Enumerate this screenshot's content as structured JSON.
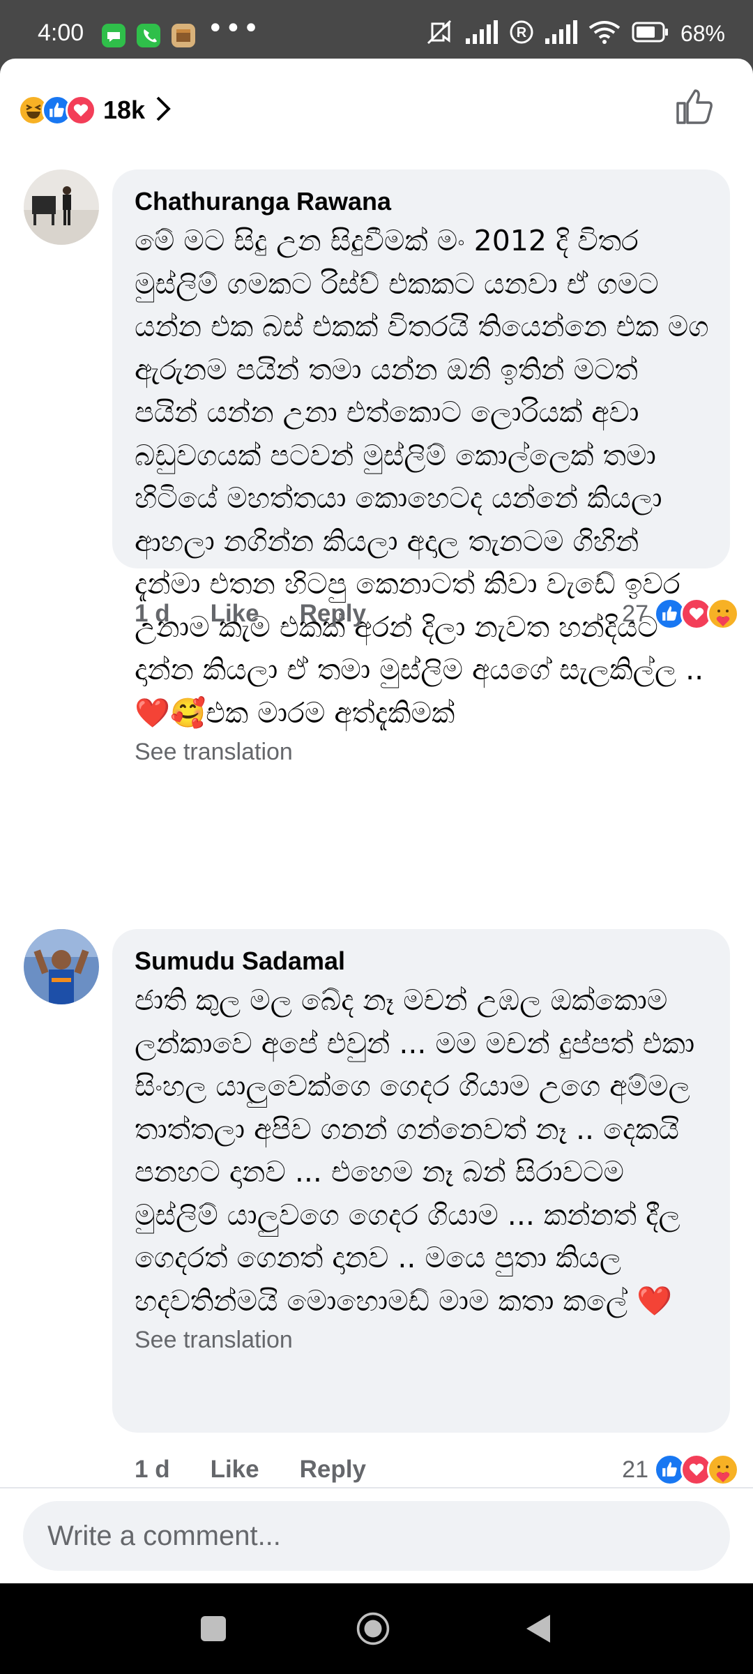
{
  "status_bar": {
    "time": "4:00",
    "dots": "•••",
    "battery": "68%",
    "icons": [
      "messages-icon",
      "phone-icon",
      "package-icon",
      "mute-icon",
      "signal-icon",
      "roaming-icon",
      "signal-icon",
      "wifi-icon",
      "battery-icon"
    ]
  },
  "reactions_summary": {
    "count": "18k",
    "icons": [
      "haha-icon",
      "like-icon",
      "love-icon"
    ]
  },
  "comments": [
    {
      "author": "Chathuranga Rawana",
      "text": "මේ මට සිදු උන සිදුවීමක් මං 2012 දි විතර මුස්ලිම් ගමකට රිස්ව් එකකට යනවා ඒ ගමට යන්න එක බස් එකක් විතරයි තියෙන්නෙ එක මග ඇරුනම පයින් තමා යන්න ඔනි ඉතින් මටත් පයින් යන්න උනා එත්කොට ලොරියක් අවා බඩුවගයක් පටවන් මුස්ලිම් කොල්ලෙක් තමා හිටියේ මහත්තයා කොහෙටද යන්නේ කියලා ආහලා නගින්න කියලා අදාල තැනටම ගිහින් දැන්මා එතන හිටපු කෙනාටත් කිවා වැඩේ ඉවර උනාම කැම එකක් අරන් දිලා නැවත හන්දියට දාන්න කියලා ඒ තමා මුස්ලිම අයගේ සැලකිල්ල ..❤️🥰එක මාරම අත්දැකිමක්",
      "see_translation": "See translation",
      "age": "1 d",
      "like": "Like",
      "reply": "Reply",
      "reaction_count": "27",
      "reaction_icons": [
        "like-icon",
        "love-icon",
        "care-icon"
      ]
    },
    {
      "author": "Sumudu Sadamal",
      "text": "ජාති කුල මල බේද නෑ මචන් උඹල ඔක්කොම ලන්කාවෙ අපේ එවුන් ... මම මචන් දුප්පත් එකා සිංහල යාලුවෙක්ගෙ ගෙදර ගියාම උගෙ අම්මල තාත්තලා අපිව ගනන් ගන්නෙවත් නෑ .. දෙකයි පනහට දානව ... එහෙම නෑ බන් සිරාවටම මුස්ලිම් යාලුවගෙ ගෙදර ගියාම ... කන්නත් දීල ගෙදරත් ගෙනත් දානව .. මයෙ පුතා කියල හදවතින්මයි මොහොමඩ් මාම කතා කලේ ❤️",
      "see_translation": "See translation",
      "age": "1 d",
      "like": "Like",
      "reply": "Reply",
      "reaction_count": "21",
      "reaction_icons": [
        "like-icon",
        "love-icon",
        "care-icon"
      ]
    }
  ],
  "composer": {
    "placeholder": "Write a comment..."
  },
  "colors": {
    "like_blue": "#1877f2",
    "love_red": "#f33e58",
    "haha_yellow": "#f7b125",
    "bubble_gray": "#f0f2f5",
    "secondary_text": "#65676b"
  }
}
